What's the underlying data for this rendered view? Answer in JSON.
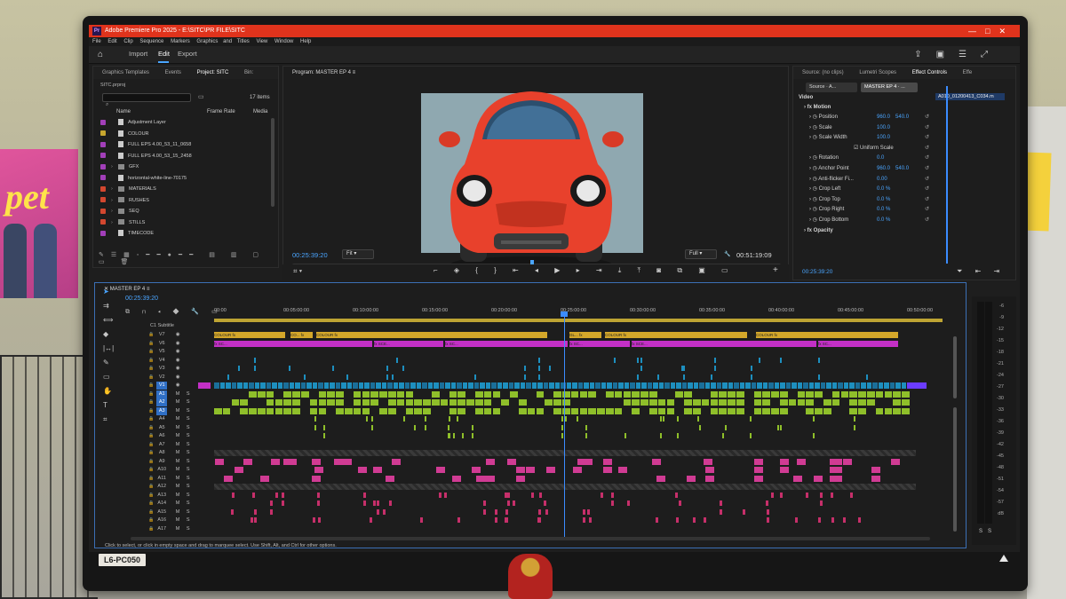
{
  "app": {
    "title": "Adobe Premiere Pro 2025 - E:\\SITC\\PR FILE\\SITC",
    "badge": "Pr",
    "window_controls": [
      "—",
      "□",
      "✕"
    ]
  },
  "menu": [
    "File",
    "Edit",
    "Clip",
    "Sequence",
    "Markers",
    "Graphics and Titles",
    "View",
    "Window",
    "Help"
  ],
  "workspace": {
    "tabs": [
      "Import",
      "Edit",
      "Export"
    ],
    "active": "Edit"
  },
  "project_panel": {
    "tabs": [
      "Graphics Templates",
      "Events",
      "Project: SITC",
      "Bin:"
    ],
    "active_tab": "Project: SITC",
    "file": "SITC.prproj",
    "items_count": "17 items",
    "columns": [
      "Name",
      "Frame Rate",
      "Media"
    ],
    "items": [
      {
        "name": "Adjustment Layer",
        "kind": "clip",
        "color": "#a23fb9"
      },
      {
        "name": "COLOUR",
        "kind": "clip",
        "color": "#c7a62e"
      },
      {
        "name": "FULL EPS 4.00_53_11_0658",
        "kind": "clip",
        "color": "#a23fb9"
      },
      {
        "name": "FULL EPS 4.00_53_15_2458",
        "kind": "clip",
        "color": "#a23fb9"
      },
      {
        "name": "GFX",
        "kind": "bin",
        "color": "#a23fb9"
      },
      {
        "name": "horizontal-white-line-70175",
        "kind": "clip",
        "color": "#a23fb9"
      },
      {
        "name": "MATERIALS",
        "kind": "bin",
        "color": "#d3472f"
      },
      {
        "name": "RUSHES",
        "kind": "bin",
        "color": "#d3472f"
      },
      {
        "name": "SEQ",
        "kind": "bin",
        "color": "#d3472f"
      },
      {
        "name": "STILLS",
        "kind": "bin",
        "color": "#d3472f"
      },
      {
        "name": "TIMECODE",
        "kind": "clip",
        "color": "#a23fb9"
      }
    ]
  },
  "program_monitor": {
    "tab": "Program: MASTER EP 4",
    "timecode": "00:25:39:20",
    "fit": "Fit",
    "quality": "Full",
    "duration": "00:51:19:09"
  },
  "effect_controls": {
    "tabs": [
      "Source: (no clips)",
      "Lumetri Scopes",
      "Effect Controls",
      "Effe"
    ],
    "active_tab": "Effect Controls",
    "source_btn": "Source · A...",
    "seq_btn": "MASTER EP 4 · ...",
    "clip_name": "A010_01200413_C034.m",
    "video_label": "Video",
    "sections": [
      "Motion",
      "Opacity"
    ],
    "rows": [
      {
        "label": "Position",
        "v1": "960.0",
        "v2": "540.0"
      },
      {
        "label": "Scale",
        "v1": "100.0",
        "v2": ""
      },
      {
        "label": "Scale Width",
        "v1": "100.0",
        "v2": ""
      },
      {
        "label": "Uniform Scale",
        "v1": "",
        "v2": ""
      },
      {
        "label": "Rotation",
        "v1": "0.0",
        "v2": ""
      },
      {
        "label": "Anchor Point",
        "v1": "960.0",
        "v2": "540.0"
      },
      {
        "label": "Anti-flicker Fi...",
        "v1": "0.00",
        "v2": ""
      },
      {
        "label": "Crop Left",
        "v1": "0.0 %",
        "v2": ""
      },
      {
        "label": "Crop Top",
        "v1": "0.0 %",
        "v2": ""
      },
      {
        "label": "Crop Right",
        "v1": "0.0 %",
        "v2": ""
      },
      {
        "label": "Crop Bottom",
        "v1": "0.0 %",
        "v2": ""
      }
    ],
    "timecode": "00:25:39:20"
  },
  "timeline": {
    "tab": "MASTER EP 4",
    "timecode": "00:25:39:20",
    "ruler": [
      "00:00",
      "00:05:00:00",
      "00:10:00:00",
      "00:15:00:00",
      "00:20:00:00",
      "00:25:00:00",
      "00:30:00:00",
      "00:35:00:00",
      "00:40:00:00",
      "00:45:00:00",
      "00:50:00:00"
    ],
    "subtitle_label": "Subtitle",
    "c1": "C1",
    "video_tracks": [
      "V7",
      "V6",
      "V5",
      "V4",
      "V3",
      "V2",
      "V1"
    ],
    "audio_tracks": [
      "A1",
      "A2",
      "A3",
      "A4",
      "A5",
      "A6",
      "A7",
      "A8",
      "A9",
      "A10",
      "A11",
      "A12",
      "A13",
      "A14",
      "A15",
      "A16",
      "A17"
    ],
    "colour_clips": [
      "COLOUR",
      "CO...",
      "COLOUR",
      "GL...",
      "COLOUR",
      "COLOUR"
    ],
    "adjustment_clips": [
      "SC...",
      "SCE...",
      "SC...",
      "SC...",
      "SCE...",
      "SC..."
    ],
    "fx_label": "fx",
    "m_label": "M",
    "s_label": "S"
  },
  "meters": {
    "scale": [
      "-6",
      "-12",
      "-18",
      "-24",
      "-30",
      "-36",
      "-42",
      "-48",
      "-54",
      "dB"
    ],
    "full_scale": [
      "-9",
      "-15",
      "-21",
      "-27",
      "-33",
      "-39",
      "-45",
      "-51",
      "-57"
    ],
    "s": "S"
  },
  "status_bar": "Click to select, or click in empty space and drag to marquee select. Use Shift, Alt, and Ctrl for other options.",
  "monitor_label": "L6-PC050",
  "poster": "pet",
  "colors": {
    "title_red": "#e0331c",
    "accent_blue": "#4aa5ff",
    "video_clip_blue": "#1d8fbf",
    "audio_green": "#8fbf2a",
    "adjust_magenta": "#c330c6",
    "colour_gold": "#d4a72a",
    "playhead_blue": "#3b8cff"
  }
}
